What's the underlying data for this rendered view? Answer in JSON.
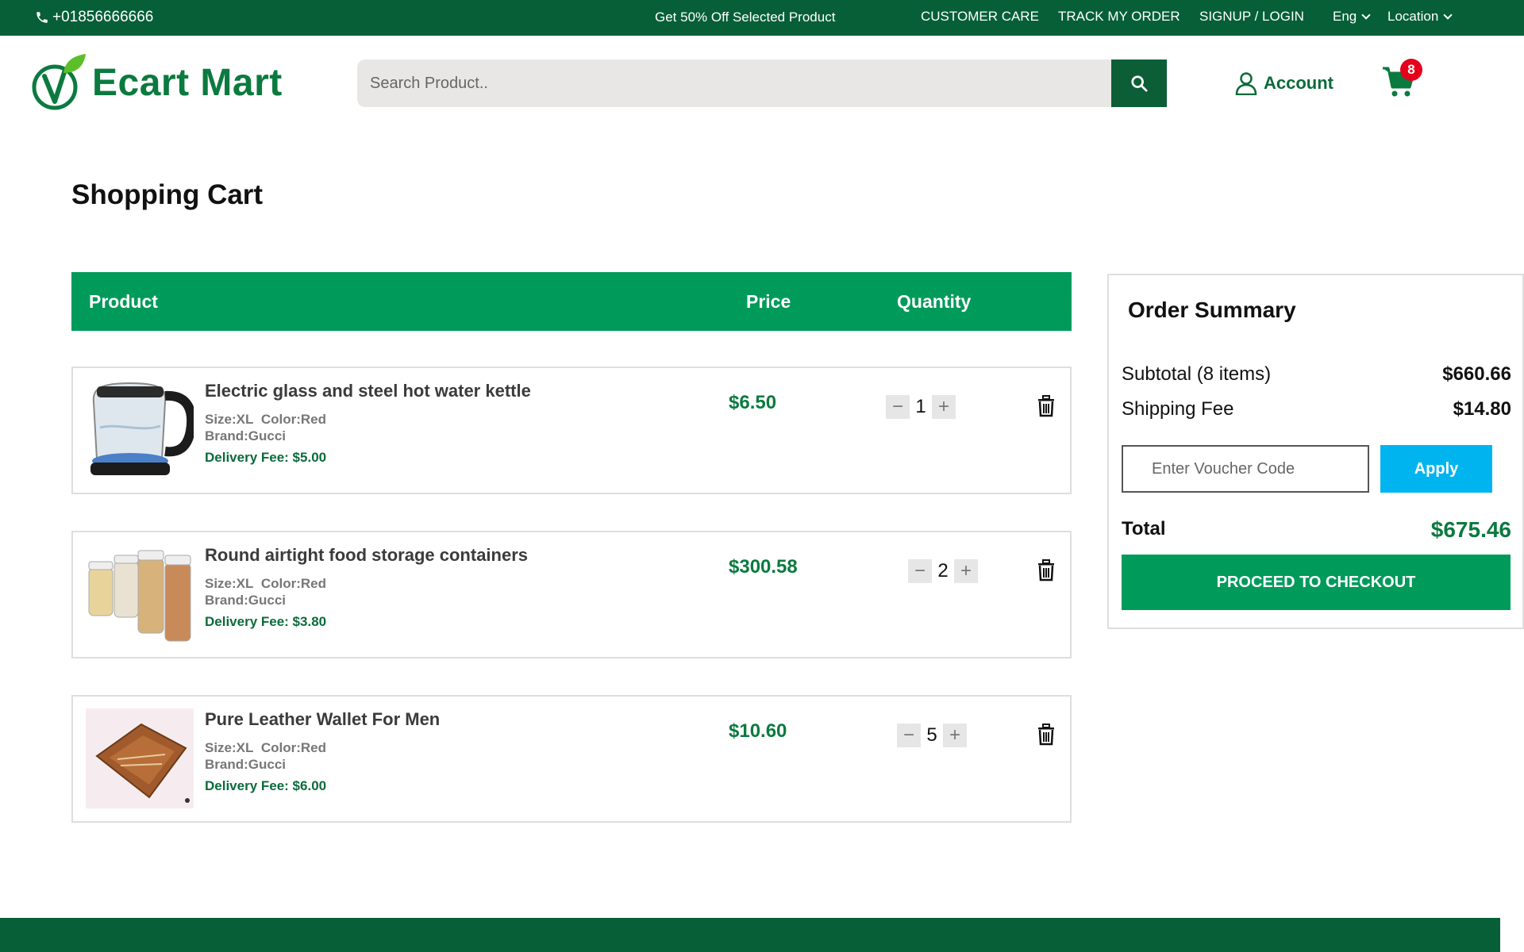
{
  "topbar": {
    "phone": "+01856666666",
    "promo": "Get 50% Off Selected Product",
    "nav": [
      "CUSTOMER CARE",
      "TRACK MY ORDER",
      "SIGNUP / LOGIN"
    ],
    "language": "Eng",
    "location": "Location"
  },
  "header": {
    "logo_text": "Ecart Mart",
    "search_placeholder": "Search Product..",
    "account_label": "Account",
    "cart_count": "8"
  },
  "page": {
    "title": "Shopping Cart"
  },
  "table": {
    "columns": [
      "Product",
      "Price",
      "Quantity"
    ]
  },
  "cart_items": [
    {
      "name": "Electric glass and steel hot water kettle",
      "size": "Size:XL",
      "color": "Color:Red",
      "brand": "Brand:Gucci",
      "delivery_fee": "Delivery Fee: $5.00",
      "price": "$6.50",
      "quantity": "1",
      "image": "kettle-image"
    },
    {
      "name": "Round airtight food storage containers",
      "size": "Size:XL",
      "color": "Color:Red",
      "brand": "Brand:Gucci",
      "delivery_fee": "Delivery Fee: $3.80",
      "price": "$300.58",
      "quantity": "2",
      "image": "jars-image"
    },
    {
      "name": "Pure Leather Wallet For Men",
      "size": "Size:XL",
      "color": "Color:Red",
      "brand": "Brand:Gucci",
      "delivery_fee": "Delivery Fee: $6.00",
      "price": "$10.60",
      "quantity": "5",
      "image": "wallet-image"
    }
  ],
  "summary": {
    "title": "Order Summary",
    "subtotal_label": "Subtotal (8 items)",
    "subtotal_value": "$660.66",
    "shipping_label": "Shipping Fee",
    "shipping_value": "$14.80",
    "voucher_placeholder": "Enter Voucher Code",
    "apply_label": "Apply",
    "total_label": "Total",
    "total_value": "$675.46",
    "checkout_label": "PROCEED TO CHECKOUT"
  },
  "colors": {
    "brand_dark": "#065f37",
    "brand_green": "#009a5b",
    "apply_blue": "#00b4f0",
    "badge_red": "#e4001b"
  }
}
